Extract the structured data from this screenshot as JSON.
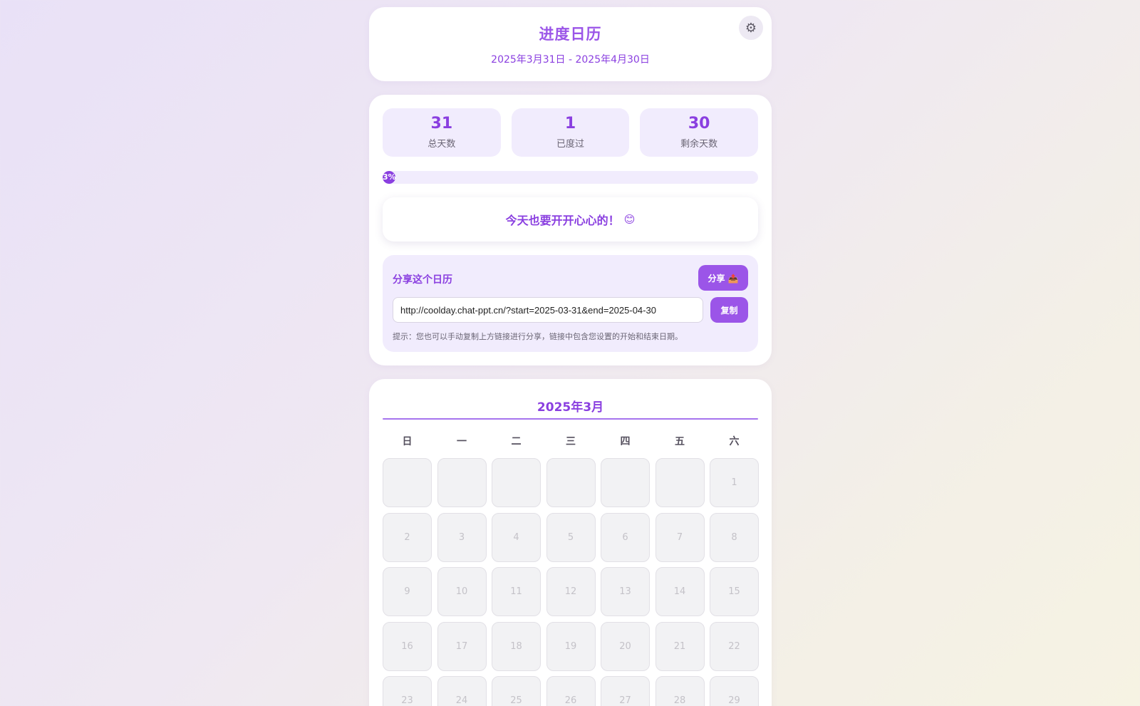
{
  "header": {
    "title": "进度日历",
    "range": "2025年3月31日 - 2025年4月30日",
    "settings_icon": "gear-icon"
  },
  "stats": [
    {
      "value": "31",
      "label": "总天数"
    },
    {
      "value": "1",
      "label": "已度过"
    },
    {
      "value": "30",
      "label": "剩余天数"
    }
  ],
  "progress": {
    "label": "3%",
    "percent": 3.2
  },
  "motto": {
    "text": "今天也要开开心心的！",
    "emoji": "😊"
  },
  "share": {
    "title": "分享这个日历",
    "share_label": "分享 📤",
    "url": "http://coolday.chat-ppt.cn/?start=2025-03-31&end=2025-04-30",
    "copy_label": "复制",
    "hint": "提示：您也可以手动复制上方链接进行分享，链接中包含您设置的开始和结束日期。"
  },
  "calendar": {
    "month_title": "2025年3月",
    "weekdays": [
      "日",
      "一",
      "二",
      "三",
      "四",
      "五",
      "六"
    ],
    "leading_blanks": 6,
    "days": [
      "1",
      "2",
      "3",
      "4",
      "5",
      "6",
      "7",
      "8",
      "9",
      "10",
      "11",
      "12",
      "13",
      "14",
      "15",
      "16",
      "17",
      "18",
      "19",
      "20",
      "21",
      "22",
      "23",
      "24",
      "25",
      "26",
      "27",
      "28",
      "29"
    ]
  },
  "colors": {
    "accent": "#8a3fe0",
    "button": "#9b55e8",
    "panel": "#f1ecfd"
  }
}
